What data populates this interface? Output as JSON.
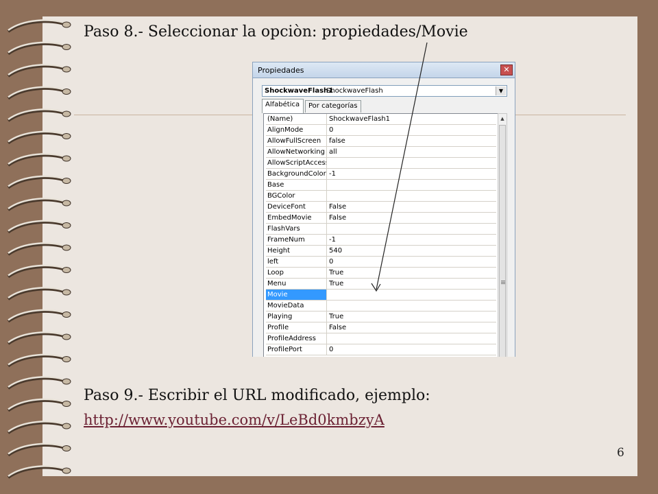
{
  "slide": {
    "step8": "Paso 8.- Seleccionar la opciòn: propiedades/Movie",
    "step9": "Paso 9.- Escribir el URL modificado, ejemplo:",
    "url": "http://www.youtube.com/v/LeBd0kmbzyA",
    "page_number": "6"
  },
  "window": {
    "title": "Propiedades",
    "close_glyph": "✕",
    "object_name": "ShockwaveFlash1",
    "object_type": "ShockwaveFlash",
    "dropdown_glyph": "▼",
    "tabs": [
      "Alfabética",
      "Por categorías"
    ],
    "selected_property": "Movie",
    "properties": [
      {
        "name": "(Name)",
        "value": "ShockwaveFlash1"
      },
      {
        "name": "AlignMode",
        "value": "0"
      },
      {
        "name": "AllowFullScreen",
        "value": "false"
      },
      {
        "name": "AllowNetworking",
        "value": "all"
      },
      {
        "name": "AllowScriptAccess",
        "value": ""
      },
      {
        "name": "BackgroundColor",
        "value": "-1"
      },
      {
        "name": "Base",
        "value": ""
      },
      {
        "name": "BGColor",
        "value": ""
      },
      {
        "name": "DeviceFont",
        "value": "False"
      },
      {
        "name": "EmbedMovie",
        "value": "False"
      },
      {
        "name": "FlashVars",
        "value": ""
      },
      {
        "name": "FrameNum",
        "value": "-1"
      },
      {
        "name": "Height",
        "value": "540"
      },
      {
        "name": "left",
        "value": "0"
      },
      {
        "name": "Loop",
        "value": "True"
      },
      {
        "name": "Menu",
        "value": "True"
      },
      {
        "name": "Movie",
        "value": ""
      },
      {
        "name": "MovieData",
        "value": ""
      },
      {
        "name": "Playing",
        "value": "True"
      },
      {
        "name": "Profile",
        "value": "False"
      },
      {
        "name": "ProfileAddress",
        "value": ""
      },
      {
        "name": "ProfilePort",
        "value": "0"
      }
    ]
  },
  "colors": {
    "frame": "#8f705a",
    "paper": "#ece6e0",
    "selection": "#3399ff",
    "link": "#6b2133"
  }
}
